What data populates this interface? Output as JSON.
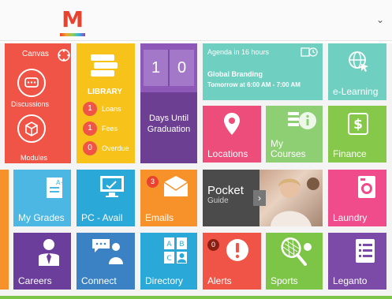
{
  "header": {
    "logo_letter": "M"
  },
  "canvas_tile": {
    "title": "Canvas",
    "discussions": "Discussions",
    "modules": "Modules"
  },
  "library_tile": {
    "title": "LIBRARY",
    "rows": [
      {
        "count": "1",
        "label": "Loans"
      },
      {
        "count": "1",
        "label": "Fees"
      },
      {
        "count": "0",
        "label": "Overdue"
      }
    ]
  },
  "countdown_tile": {
    "digit1": "1",
    "digit2": "0",
    "label_line1": "Days Until",
    "label_line2": "Graduation"
  },
  "agenda_tile": {
    "title": "Agenda in 16 hours",
    "event": "Global Branding",
    "time": "Tomorrow at 6:00 AM - 7:00 AM"
  },
  "elearning_tile": {
    "label": "e-Learning"
  },
  "locations_tile": {
    "label": "Locations"
  },
  "mycourses_tile": {
    "label_line1": "My",
    "label_line2": "Courses"
  },
  "finance_tile": {
    "label": "Finance"
  },
  "mygrades_tile": {
    "label": "My Grades"
  },
  "pcavail_tile": {
    "label": "PC - Avail"
  },
  "emails_tile": {
    "label": "Emails",
    "badge": "3"
  },
  "pocketguide_tile": {
    "title": "Pocket",
    "subtitle": "Guide"
  },
  "laundry_tile": {
    "label": "Laundry"
  },
  "careers_tile": {
    "label": "Careers"
  },
  "connect_tile": {
    "label": "Connect"
  },
  "directory_tile": {
    "label": "Directory"
  },
  "alerts_tile": {
    "label": "Alerts",
    "badge": "0"
  },
  "sports_tile": {
    "label": "Sports"
  },
  "leganto_tile": {
    "label": "Leganto"
  }
}
